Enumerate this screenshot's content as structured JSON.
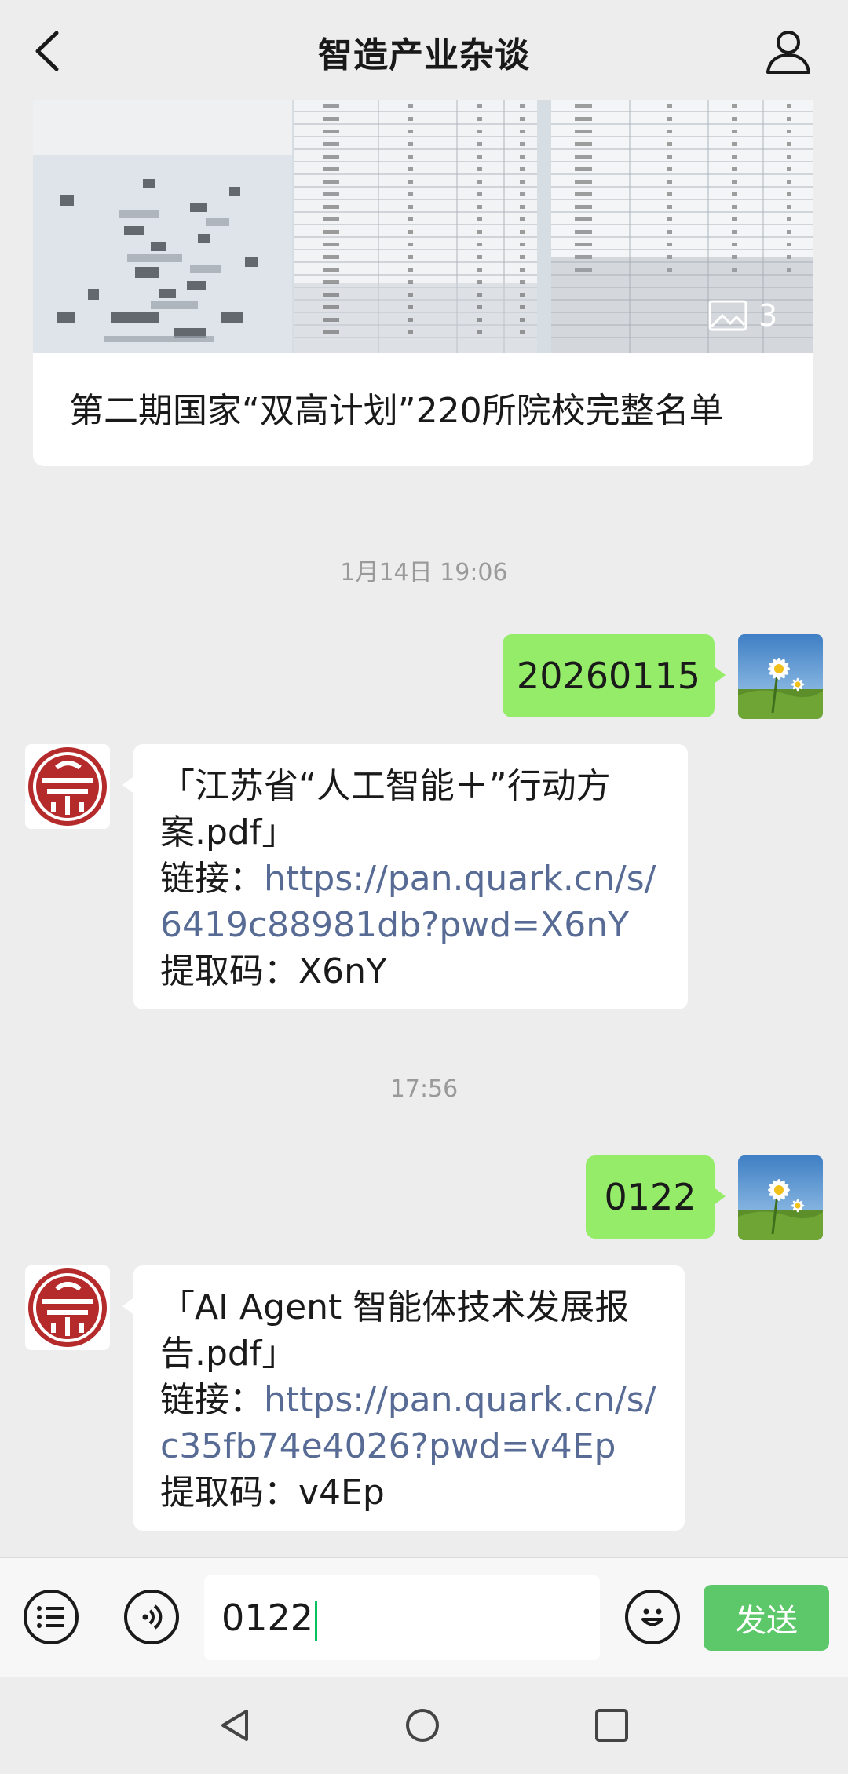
{
  "header": {
    "title": "智造产业杂谈",
    "back_icon": "chevron-left-icon",
    "profile_icon": "person-icon"
  },
  "article": {
    "title": "第二期国家“双高计划”220所院校完整名单",
    "image_count": "3"
  },
  "messages": [
    {
      "type": "timestamp",
      "text": "1月14日 19:06"
    },
    {
      "type": "outgoing",
      "text": "20260115"
    },
    {
      "type": "incoming",
      "title": "「江苏省“人工智能＋”行动方案.pdf」",
      "link_label": "链接：",
      "link": "https://pan.quark.cn/s/6419c88981db?pwd=X6nY",
      "code_label": "提取码：",
      "code": "X6nY"
    },
    {
      "type": "timestamp",
      "text": "17:56"
    },
    {
      "type": "outgoing",
      "text": "0122"
    },
    {
      "type": "incoming",
      "title": "「AI Agent 智能体技术发展报告.pdf」",
      "link_label": "链接：",
      "link": "https://pan.quark.cn/s/c35fb74e4026?pwd=v4Ep",
      "code_label": "提取码：",
      "code": "v4Ep"
    }
  ],
  "input": {
    "value": "0122",
    "send_label": "发送"
  },
  "colors": {
    "outgoing_bubble": "#95ec69",
    "link": "#576b95",
    "send_button": "#5cc86a",
    "background": "#ededed"
  }
}
